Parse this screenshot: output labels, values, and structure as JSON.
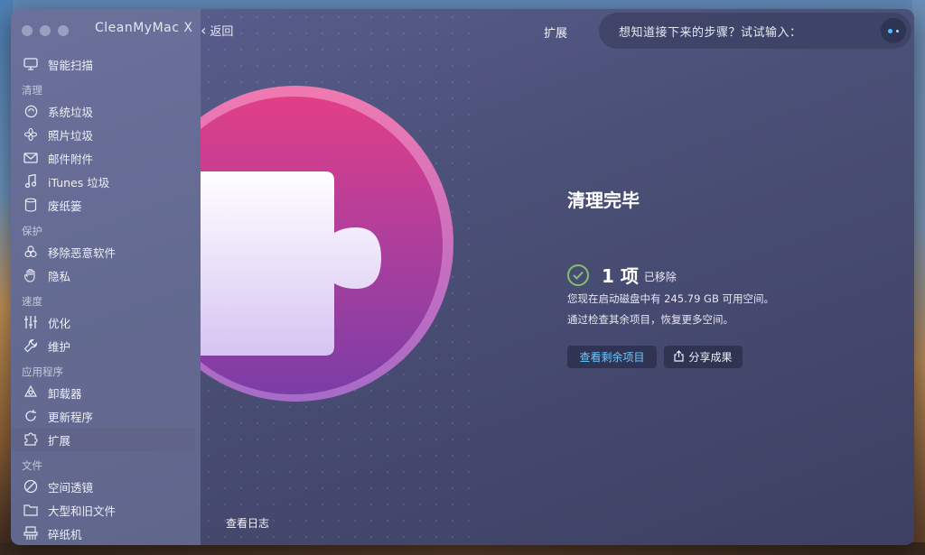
{
  "window": {
    "app_title": "CleanMyMac X"
  },
  "header": {
    "back_label": "返回",
    "title": "扩展"
  },
  "assistant": {
    "prompt": "想知道接下来的步骤？试试输入："
  },
  "sidebar": {
    "top": {
      "label": "智能扫描",
      "icon": "monitor-icon"
    },
    "sections": [
      {
        "title": "清理",
        "items": [
          {
            "label": "系统垃圾",
            "icon": "system-junk-icon"
          },
          {
            "label": "照片垃圾",
            "icon": "flower-icon"
          },
          {
            "label": "邮件附件",
            "icon": "mail-icon"
          },
          {
            "label": "iTunes 垃圾",
            "icon": "music-note-icon"
          },
          {
            "label": "废纸篓",
            "icon": "trash-icon"
          }
        ]
      },
      {
        "title": "保护",
        "items": [
          {
            "label": "移除恶意软件",
            "icon": "biohazard-icon"
          },
          {
            "label": "隐私",
            "icon": "hand-icon"
          }
        ]
      },
      {
        "title": "速度",
        "items": [
          {
            "label": "优化",
            "icon": "sliders-icon"
          },
          {
            "label": "维护",
            "icon": "wrench-icon"
          }
        ]
      },
      {
        "title": "应用程序",
        "items": [
          {
            "label": "卸载器",
            "icon": "uninstaller-icon"
          },
          {
            "label": "更新程序",
            "icon": "update-icon"
          },
          {
            "label": "扩展",
            "icon": "extension-icon",
            "active": true
          }
        ]
      },
      {
        "title": "文件",
        "items": [
          {
            "label": "空间透镜",
            "icon": "space-lens-icon"
          },
          {
            "label": "大型和旧文件",
            "icon": "folder-icon"
          },
          {
            "label": "碎纸机",
            "icon": "shredder-icon"
          }
        ]
      }
    ]
  },
  "footer": {
    "view_log": "查看日志"
  },
  "result": {
    "title": "清理完毕",
    "count": "1 项",
    "count_label": "已移除",
    "free_space_text": "您现在启动磁盘中有 245.79 GB 可用空间。",
    "hint_text": "通过检查其余项目，恢复更多空间。",
    "primary_button": "查看剩余项目",
    "share_button": "分享成果"
  },
  "colors": {
    "accent": "#6ec8ff",
    "check": "#86c06c",
    "hero_pink": "#e13f86",
    "hero_purple": "#7b3da6"
  }
}
